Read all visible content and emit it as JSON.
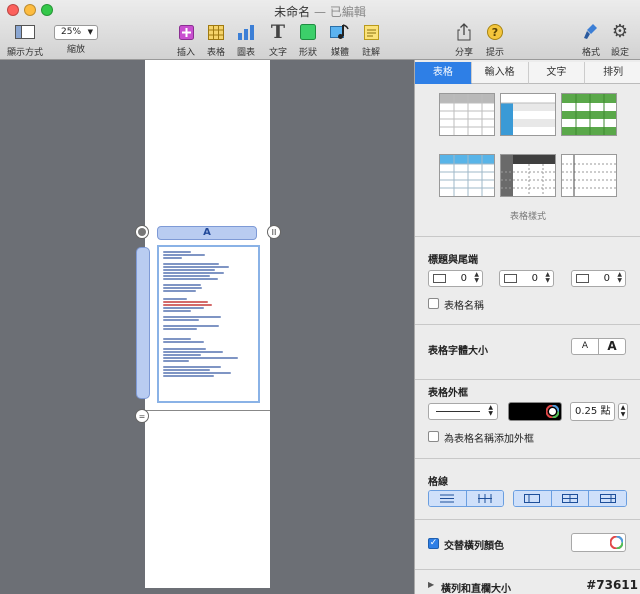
{
  "window": {
    "title": "未命名",
    "edited": "— 已編輯"
  },
  "toolbar": {
    "view": "顯示方式",
    "zoom_value": "25%",
    "zoom": "縮放",
    "insert": "插入",
    "table": "表格",
    "chart": "圖表",
    "text": "文字",
    "shape": "形狀",
    "media": "媒體",
    "comment": "註解",
    "share": "分享",
    "tips": "提示",
    "format": "格式",
    "setup": "設定"
  },
  "canvas": {
    "column_header": "A"
  },
  "panel": {
    "tabs": [
      "表格",
      "輸入格",
      "文字",
      "排列"
    ],
    "table_styles_label": "表格樣式",
    "header_footer": {
      "title": "標題與尾端",
      "header_rows": "0",
      "header_cols": "0",
      "footer_rows": "0"
    },
    "table_name_checkbox": "表格名稱",
    "font_size": {
      "title": "表格字體大小",
      "smaller": "A",
      "larger": "A"
    },
    "outline": {
      "title": "表格外框",
      "width": "0.25 點",
      "caption_checkbox": "為表格名稱添加外框"
    },
    "gridlines": {
      "title": "格線"
    },
    "alternating": {
      "label": "交替橫列顏色",
      "checked": true
    },
    "row_col_size": "橫列和直欄大小"
  },
  "colors": {
    "accent": "#2e7fe6",
    "outline_color": "#000000"
  },
  "watermark": "#73611"
}
